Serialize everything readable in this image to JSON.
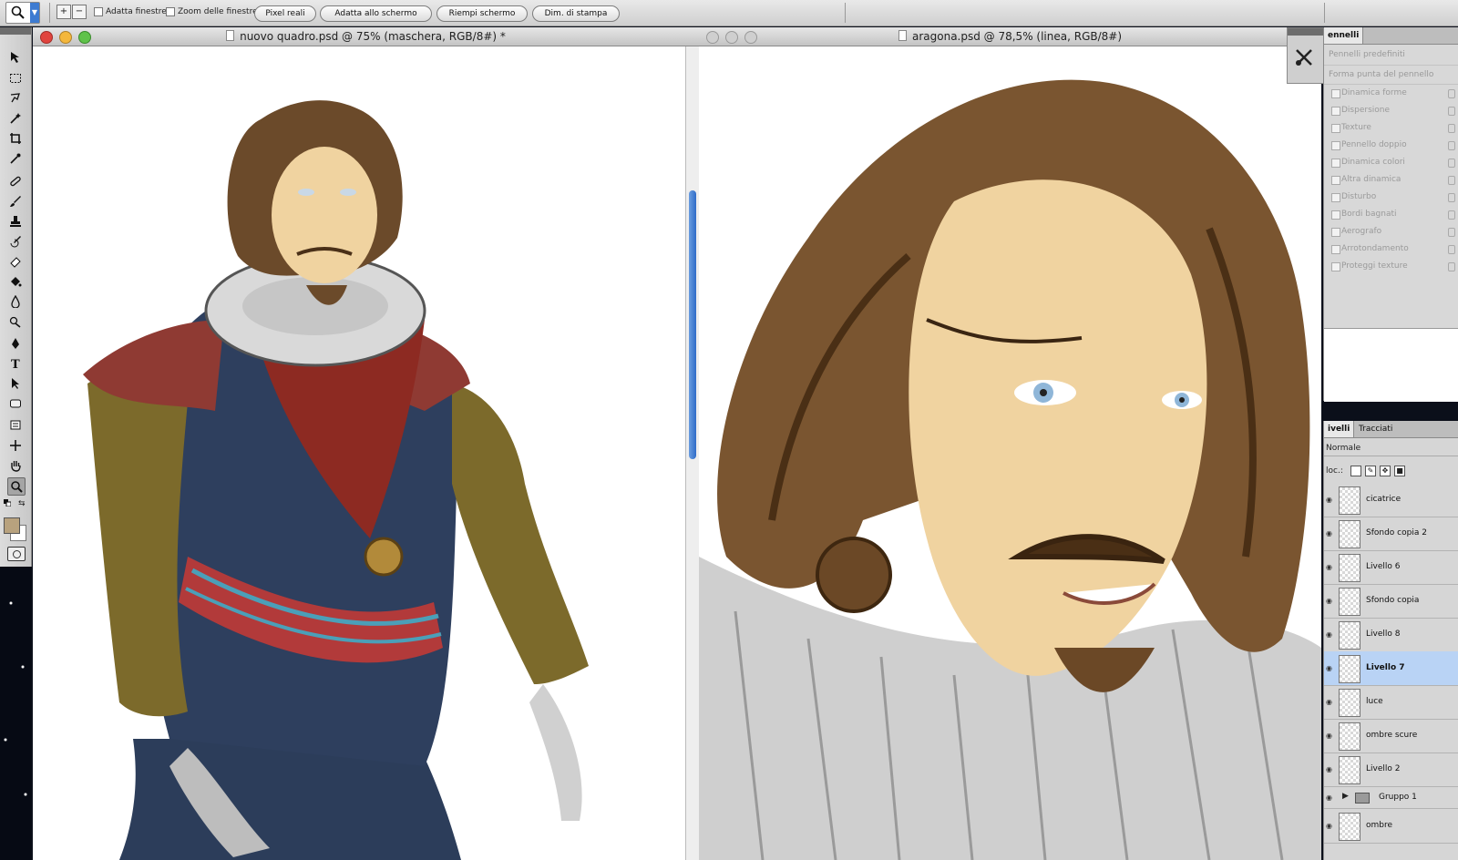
{
  "options_bar": {
    "fit_windows_label": "Adatta finestre",
    "zoom_all_label": "Zoom delle finestre",
    "buttons": [
      "Pixel reali",
      "Adatta allo schermo",
      "Riempi schermo",
      "Dim. di stampa"
    ]
  },
  "windows": [
    {
      "title": "nuovo quadro.psd @ 75% (maschera, RGB/8#) *"
    },
    {
      "title": "aragona.psd @ 78,5% (linea, RGB/8#)"
    }
  ],
  "brushes_panel": {
    "tab": "ennelli",
    "header": "Pennelli predefiniti",
    "section": "Forma punta del pennello",
    "options": [
      "Dinamica forme",
      "Dispersione",
      "Texture",
      "Pennello doppio",
      "Dinamica colori",
      "Altra dinamica",
      "Disturbo",
      "Bordi bagnati",
      "Aerografo",
      "Arrotondamento",
      "Proteggi texture"
    ]
  },
  "layers_panel": {
    "tabs": [
      "ivelli",
      "Tracciati"
    ],
    "blend_mode": "Normale",
    "lock_label": "loc.:",
    "layers": [
      {
        "name": "cicatrice"
      },
      {
        "name": "Sfondo copia 2"
      },
      {
        "name": "Livello 6"
      },
      {
        "name": "Sfondo copia"
      },
      {
        "name": "Livello 8"
      },
      {
        "name": "Livello 7",
        "selected": true
      },
      {
        "name": "luce"
      },
      {
        "name": "ombre scure"
      },
      {
        "name": "Livello 2"
      },
      {
        "name": "Gruppo 1",
        "group": true
      },
      {
        "name": "ombre"
      }
    ]
  },
  "colors": {
    "accent": "#3d7bd1",
    "selection": "#b9d3f5",
    "foreground": "#b8a27e"
  }
}
